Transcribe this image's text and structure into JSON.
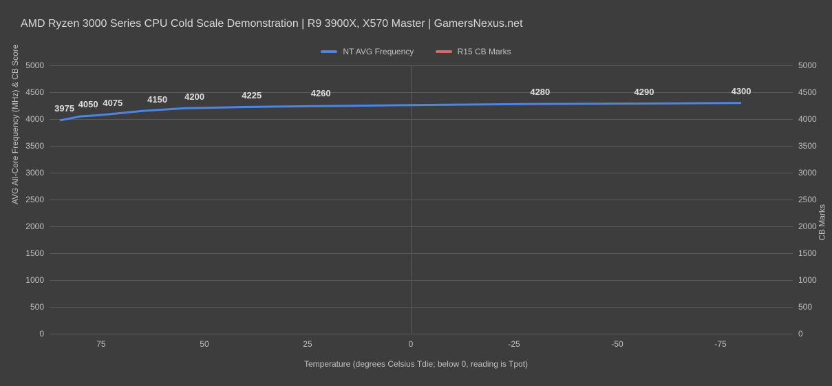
{
  "title": "AMD Ryzen 3000 Series CPU Cold Scale Demonstration | R9 3900X, X570 Master | GamersNexus.net",
  "legend": {
    "series1": {
      "label": "NT AVG Frequency",
      "color": "#4a86e8"
    },
    "series2": {
      "label": "R15 CB Marks",
      "color": "#e06666"
    }
  },
  "axes": {
    "y_left_label": "AVG All-Core Frequency (MHz) & CB Score",
    "y_right_label": "CB Marks",
    "x_label": "Temperature (degrees Celsius Tdie; below 0, reading is Tpot)",
    "y_ticks": [
      "0",
      "500",
      "1000",
      "1500",
      "2000",
      "2500",
      "3000",
      "3500",
      "4000",
      "4500",
      "5000"
    ],
    "y_min": 0,
    "y_max": 5000,
    "x_ticks": [
      "75",
      "50",
      "25",
      "0",
      "-25",
      "-50",
      "-75"
    ],
    "x_tick_positions_pct": [
      6.94,
      20.83,
      34.72,
      48.61,
      62.5,
      76.39,
      90.28
    ]
  },
  "chart_data": {
    "type": "line",
    "title": "AMD Ryzen 3000 Series CPU Cold Scale Demonstration | R9 3900X, X570 Master | GamersNexus.net",
    "xlabel": "Temperature (degrees Celsius Tdie; below 0, reading is Tpot)",
    "ylabel_left": "AVG All-Core Frequency (MHz) & CB Score",
    "ylabel_right": "CB Marks",
    "ylim": [
      0,
      5000
    ],
    "x_categories": [
      "85",
      "80",
      "75",
      "65",
      "55",
      "40",
      "30",
      "0",
      "-30",
      "-60",
      "-80"
    ],
    "x_positions_pct": [
      1.39,
      4.17,
      6.94,
      12.5,
      18.06,
      26.39,
      31.94,
      48.61,
      65.28,
      81.94,
      93.06
    ],
    "series": [
      {
        "name": "NT AVG Frequency",
        "color": "#4a86e8",
        "values": [
          3975,
          4050,
          4075,
          4150,
          4200,
          4225,
          null,
          4260,
          4280,
          4290,
          4300
        ]
      },
      {
        "name": "R15 CB Marks",
        "color": "#e06666",
        "values": [
          null,
          null,
          null,
          null,
          null,
          null,
          null,
          null,
          null,
          null,
          null
        ]
      }
    ],
    "data_labels": [
      {
        "text": "3975",
        "x_pct": 2.0,
        "y_val": 3975
      },
      {
        "text": "4050",
        "x_pct": 5.2,
        "y_val": 4050
      },
      {
        "text": "4075",
        "x_pct": 8.5,
        "y_val": 4075
      },
      {
        "text": "4150",
        "x_pct": 14.5,
        "y_val": 4150
      },
      {
        "text": "4200",
        "x_pct": 19.5,
        "y_val": 4200
      },
      {
        "text": "4225",
        "x_pct": 27.2,
        "y_val": 4225
      },
      {
        "text": "4260",
        "x_pct": 36.5,
        "y_val": 4260
      },
      {
        "text": "4280",
        "x_pct": 66.0,
        "y_val": 4280
      },
      {
        "text": "4290",
        "x_pct": 80.0,
        "y_val": 4290
      },
      {
        "text": "4300",
        "x_pct": 93.06,
        "y_val": 4300
      }
    ]
  }
}
